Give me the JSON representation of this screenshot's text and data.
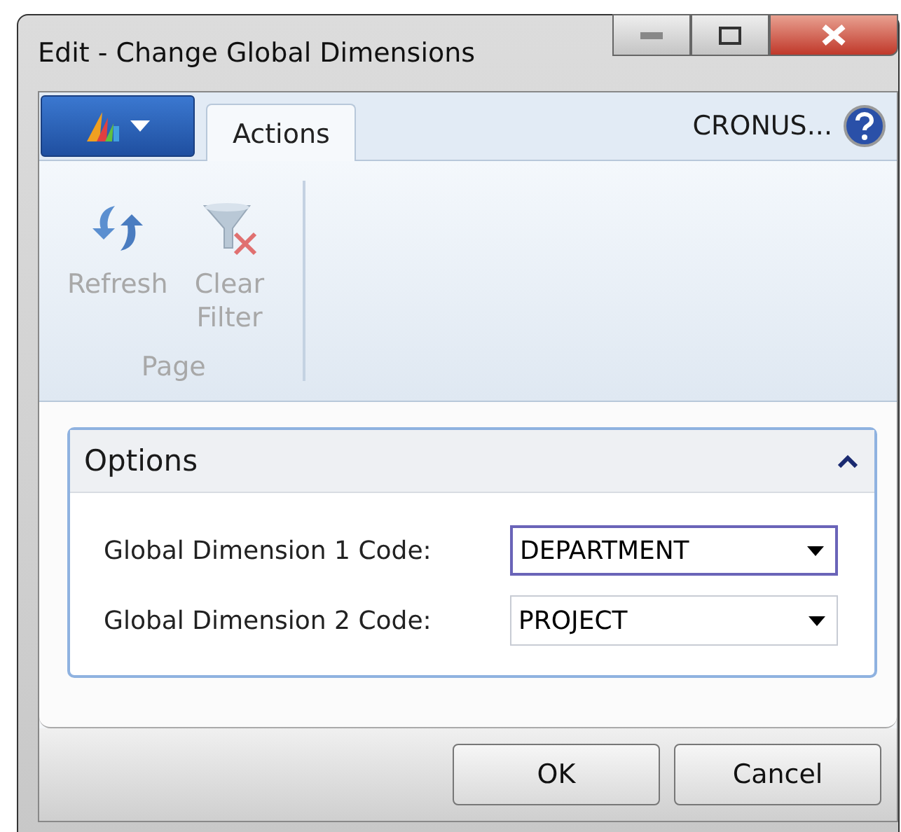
{
  "window": {
    "title": "Edit - Change Global Dimensions"
  },
  "ribbon": {
    "tabs": [
      {
        "label": "Actions",
        "selected": true
      }
    ],
    "company": "CRONUS...",
    "groups": [
      {
        "label": "Page",
        "actions": [
          {
            "label": "Refresh",
            "disabled": true
          },
          {
            "label": "Clear Filter",
            "disabled": true
          }
        ]
      }
    ]
  },
  "options": {
    "title": "Options",
    "expanded": true,
    "fields": [
      {
        "label": "Global Dimension 1 Code:",
        "value": "DEPARTMENT",
        "focused": true
      },
      {
        "label": "Global Dimension 2 Code:",
        "value": "PROJECT",
        "focused": false
      }
    ]
  },
  "buttons": [
    "OK",
    "Cancel"
  ]
}
